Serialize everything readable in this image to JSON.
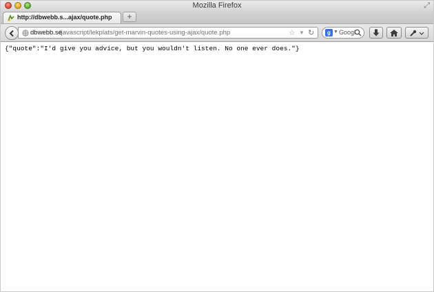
{
  "window": {
    "title": "Mozilla Firefox"
  },
  "tabs": [
    {
      "label": "http://dbwebb.s...ajax/quote.php",
      "active": true
    }
  ],
  "new_tab_label": "+",
  "urlbar": {
    "domain": "dbwebb.se",
    "path": "/javascript/lekplats/get-marvin-quotes-using-ajax/quote.php"
  },
  "search": {
    "engine": "Google",
    "text": "Googl",
    "engine_badge": "g"
  },
  "content": {
    "text": "{\"quote\":\"I'd give you advice, but you wouldn't listen. No one ever does.\"}"
  },
  "icons": {
    "back": "back-arrow-icon",
    "globe": "globe-icon",
    "bookmark": "star-icon",
    "reload": "reload-icon",
    "download": "download-icon",
    "home": "home-icon",
    "tools": "wrench-icon"
  },
  "colors": {
    "accent": "#3a6ee0"
  }
}
